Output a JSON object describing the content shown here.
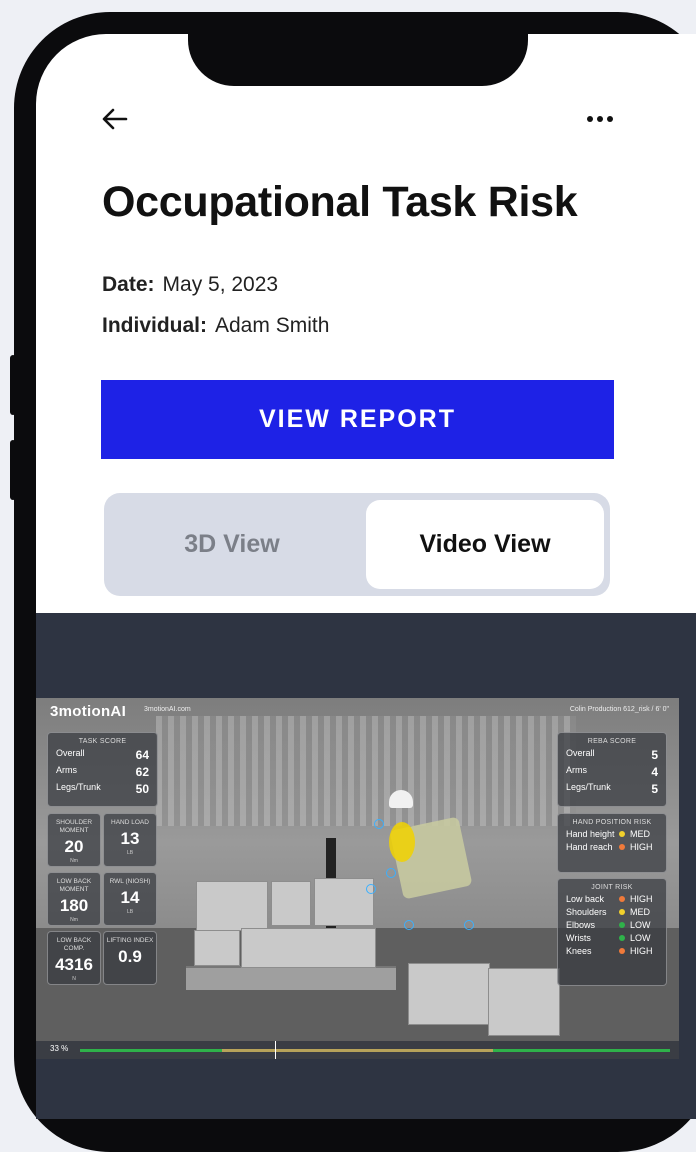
{
  "header": {
    "title": "Occupational Task Risk",
    "date_label": "Date:",
    "date_value": "May 5, 2023",
    "individual_label": "Individual:",
    "individual_value": "Adam Smith"
  },
  "actions": {
    "view_report_label": "VIEW REPORT"
  },
  "view_toggle": {
    "tabs": [
      {
        "label": "3D View",
        "selected": false
      },
      {
        "label": "Video View",
        "selected": true
      }
    ]
  },
  "video": {
    "brand": "3motionAI",
    "brand_url": "3motionAI.com",
    "top_right": "Colin Production   612_risk  /  6' 0\"",
    "task_score": {
      "title": "TASK SCORE",
      "rows": [
        {
          "label": "Overall",
          "value": "64"
        },
        {
          "label": "Arms",
          "value": "62"
        },
        {
          "label": "Legs/Trunk",
          "value": "50"
        }
      ]
    },
    "metrics": [
      {
        "label": "SHOULDER MOMENT",
        "value": "20",
        "unit": "Nm"
      },
      {
        "label": "HAND LOAD",
        "value": "13",
        "unit": "LB"
      },
      {
        "label": "LOW BACK MOMENT",
        "value": "180",
        "unit": "Nm"
      },
      {
        "label": "RWL (NIOSH)",
        "value": "14",
        "unit": "LB"
      },
      {
        "label": "LOW BACK COMP.",
        "value": "4316",
        "unit": "N"
      },
      {
        "label": "LIFTING INDEX",
        "value": "0.9",
        "unit": ""
      }
    ],
    "reba_score": {
      "title": "REBA SCORE",
      "rows": [
        {
          "label": "Overall",
          "value": "5"
        },
        {
          "label": "Arms",
          "value": "4"
        },
        {
          "label": "Legs/Trunk",
          "value": "5"
        }
      ]
    },
    "hand_position_risk": {
      "title": "HAND POSITION RISK",
      "rows": [
        {
          "label": "Hand height",
          "level": "MED",
          "color": "#f2d12c"
        },
        {
          "label": "Hand reach",
          "level": "HIGH",
          "color": "#f07a3a"
        }
      ]
    },
    "joint_risk": {
      "title": "JOINT RISK",
      "rows": [
        {
          "label": "Low back",
          "level": "HIGH",
          "color": "#f07a3a"
        },
        {
          "label": "Shoulders",
          "level": "MED",
          "color": "#f2d12c"
        },
        {
          "label": "Elbows",
          "level": "LOW",
          "color": "#2fb24a"
        },
        {
          "label": "Wrists",
          "level": "LOW",
          "color": "#2fb24a"
        },
        {
          "label": "Knees",
          "level": "HIGH",
          "color": "#f07a3a"
        }
      ]
    },
    "progress_label": "33 %",
    "progress": 0.33
  },
  "colors": {
    "accent": "#1e22e6",
    "risk_high": "#f07a3a",
    "risk_med": "#f2d12c",
    "risk_low": "#2fb24a"
  },
  "icons": [
    "back-arrow-icon",
    "more-options-icon"
  ]
}
